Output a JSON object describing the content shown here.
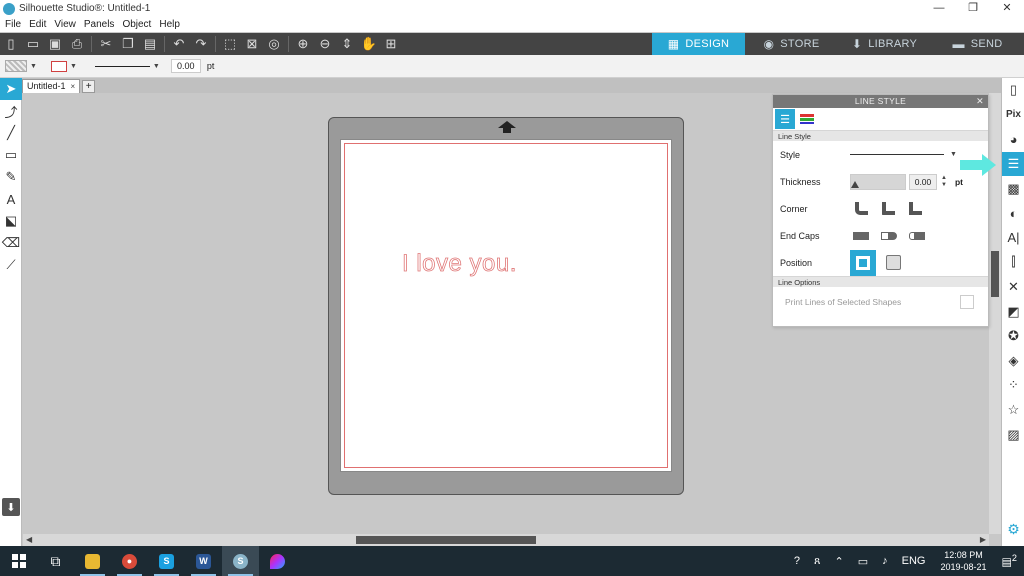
{
  "window": {
    "title": "Silhouette Studio®: Untitled-1",
    "minimize": "—",
    "maximize": "❐",
    "close": "✕"
  },
  "menu": [
    "File",
    "Edit",
    "View",
    "Panels",
    "Object",
    "Help"
  ],
  "toolbar_icons": [
    "new-icon",
    "open-icon",
    "save-icon",
    "print-icon",
    "cut-icon",
    "copy-icon",
    "paste-icon",
    "undo-icon",
    "redo-icon",
    "select-all-icon",
    "deselect-icon",
    "replicate-icon",
    "zoom-in-icon",
    "zoom-out-icon",
    "zoom-fit-icon",
    "pan-icon",
    "fit-page-icon"
  ],
  "top_tabs": [
    {
      "label": "DESIGN",
      "active": true,
      "icon": "grid-icon"
    },
    {
      "label": "STORE",
      "active": false,
      "icon": "store-icon"
    },
    {
      "label": "LIBRARY",
      "active": false,
      "icon": "library-icon"
    },
    {
      "label": "SEND",
      "active": false,
      "icon": "send-icon"
    }
  ],
  "props": {
    "line_value": "0.00",
    "line_unit": "pt"
  },
  "doc_tab": {
    "name": "Untitled-1",
    "close": "×",
    "new": "+"
  },
  "canvas": {
    "text_object": "I love you."
  },
  "line_style_panel": {
    "title": "LINE STYLE",
    "close": "✕",
    "section_line_style": "Line Style",
    "style_label": "Style",
    "thickness_label": "Thickness",
    "thickness_value": "0.00",
    "thickness_unit": "pt",
    "corner_label": "Corner",
    "end_caps_label": "End Caps",
    "position_label": "Position",
    "section_line_options": "Line Options",
    "print_lines_label": "Print Lines of Selected Shapes"
  },
  "taskbar": {
    "time": "12:08 PM",
    "date": "2019-08-21",
    "lang": "ENG",
    "notifications": "2"
  },
  "colors": {
    "accent": "#29a8d4",
    "toolbar": "#444444",
    "callout": "#5ee8e0",
    "text_stroke": "#e07878"
  }
}
